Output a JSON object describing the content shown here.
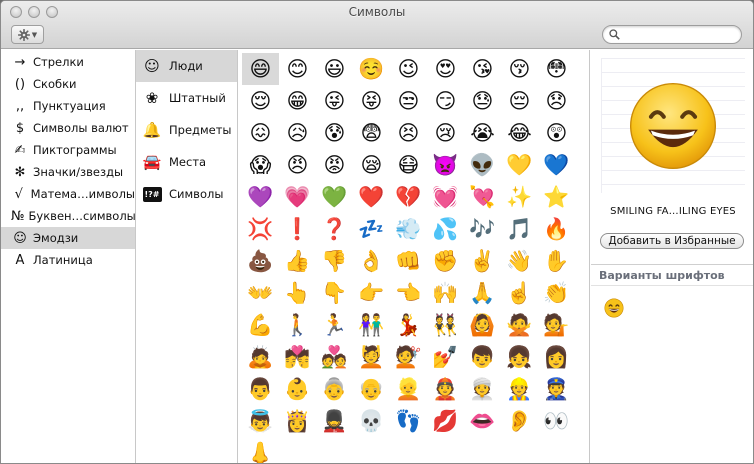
{
  "window": {
    "title": "Символы"
  },
  "toolbar": {
    "search_value": ""
  },
  "categories": [
    {
      "icon": "→",
      "label": "Стрелки"
    },
    {
      "icon": "()",
      "label": "Скобки"
    },
    {
      "icon": ",,",
      "label": "Пунктуация"
    },
    {
      "icon": "$",
      "label": "Символы валют"
    },
    {
      "icon": "✍",
      "label": "Пиктограммы"
    },
    {
      "icon": "✻",
      "label": "Значки/звезды"
    },
    {
      "icon": "√",
      "label": "Матема…имволы"
    },
    {
      "icon": "№",
      "label": "Буквен…символы"
    },
    {
      "icon": "☺",
      "label": "Эмодзи",
      "selected": true
    },
    {
      "icon": "A",
      "label": "Латиница"
    }
  ],
  "subcategories": [
    {
      "icon": "smiley-face-icon",
      "glyph": "☺",
      "label": "Люди",
      "selected": true
    },
    {
      "icon": "flower-icon",
      "glyph": "❀",
      "label": "Штатный"
    },
    {
      "icon": "bell-icon",
      "glyph": "🔔",
      "label": "Предметы"
    },
    {
      "icon": "car-icon",
      "glyph": "🚘",
      "label": "Места"
    },
    {
      "icon": "symbols-box-icon",
      "glyph": "!?#",
      "label": "Символы"
    }
  ],
  "emoji_grid": [
    "😄",
    "😊",
    "😃",
    "☺️",
    "😉",
    "😍",
    "😘",
    "😚",
    "😳",
    "😌",
    "😁",
    "😜",
    "😝",
    "😒",
    "😏",
    "😓",
    "😔",
    "😞",
    "😖",
    "😥",
    "😰",
    "😨",
    "😣",
    "😢",
    "😭",
    "😂",
    "😲",
    "😱",
    "😠",
    "😡",
    "😪",
    "😷",
    "👿",
    "👽",
    "💛",
    "💙",
    "💜",
    "💗",
    "💚",
    "❤️",
    "💔",
    "💓",
    "💘",
    "✨",
    "⭐",
    "💢",
    "❗",
    "❓",
    "💤",
    "💨",
    "💦",
    "🎶",
    "🎵",
    "🔥",
    "💩",
    "👍",
    "👎",
    "👌",
    "👊",
    "✊",
    "✌️",
    "👋",
    "✋",
    "👐",
    "👆",
    "👇",
    "👉",
    "👈",
    "🙌",
    "🙏",
    "☝️",
    "👏",
    "💪",
    "🚶",
    "🏃",
    "👫",
    "💃",
    "👯",
    "🙆",
    "🙅",
    "💁",
    "🙇",
    "💏",
    "💑",
    "💆",
    "💇",
    "💅",
    "👦",
    "👧",
    "👩",
    "👨",
    "👶",
    "👵",
    "👴",
    "👱",
    "👲",
    "👳",
    "👷",
    "👮",
    "👼",
    "👸",
    "💂",
    "💀",
    "👣",
    "💋",
    "👄",
    "👂",
    "👀",
    "👃"
  ],
  "detail": {
    "preview_glyph": "😄",
    "char_name": "SMILING FA…ILING EYES",
    "favorite_button": "Добавить в Избранные",
    "variants_header": "Варианты шрифтов",
    "variants": [
      "😄"
    ]
  }
}
